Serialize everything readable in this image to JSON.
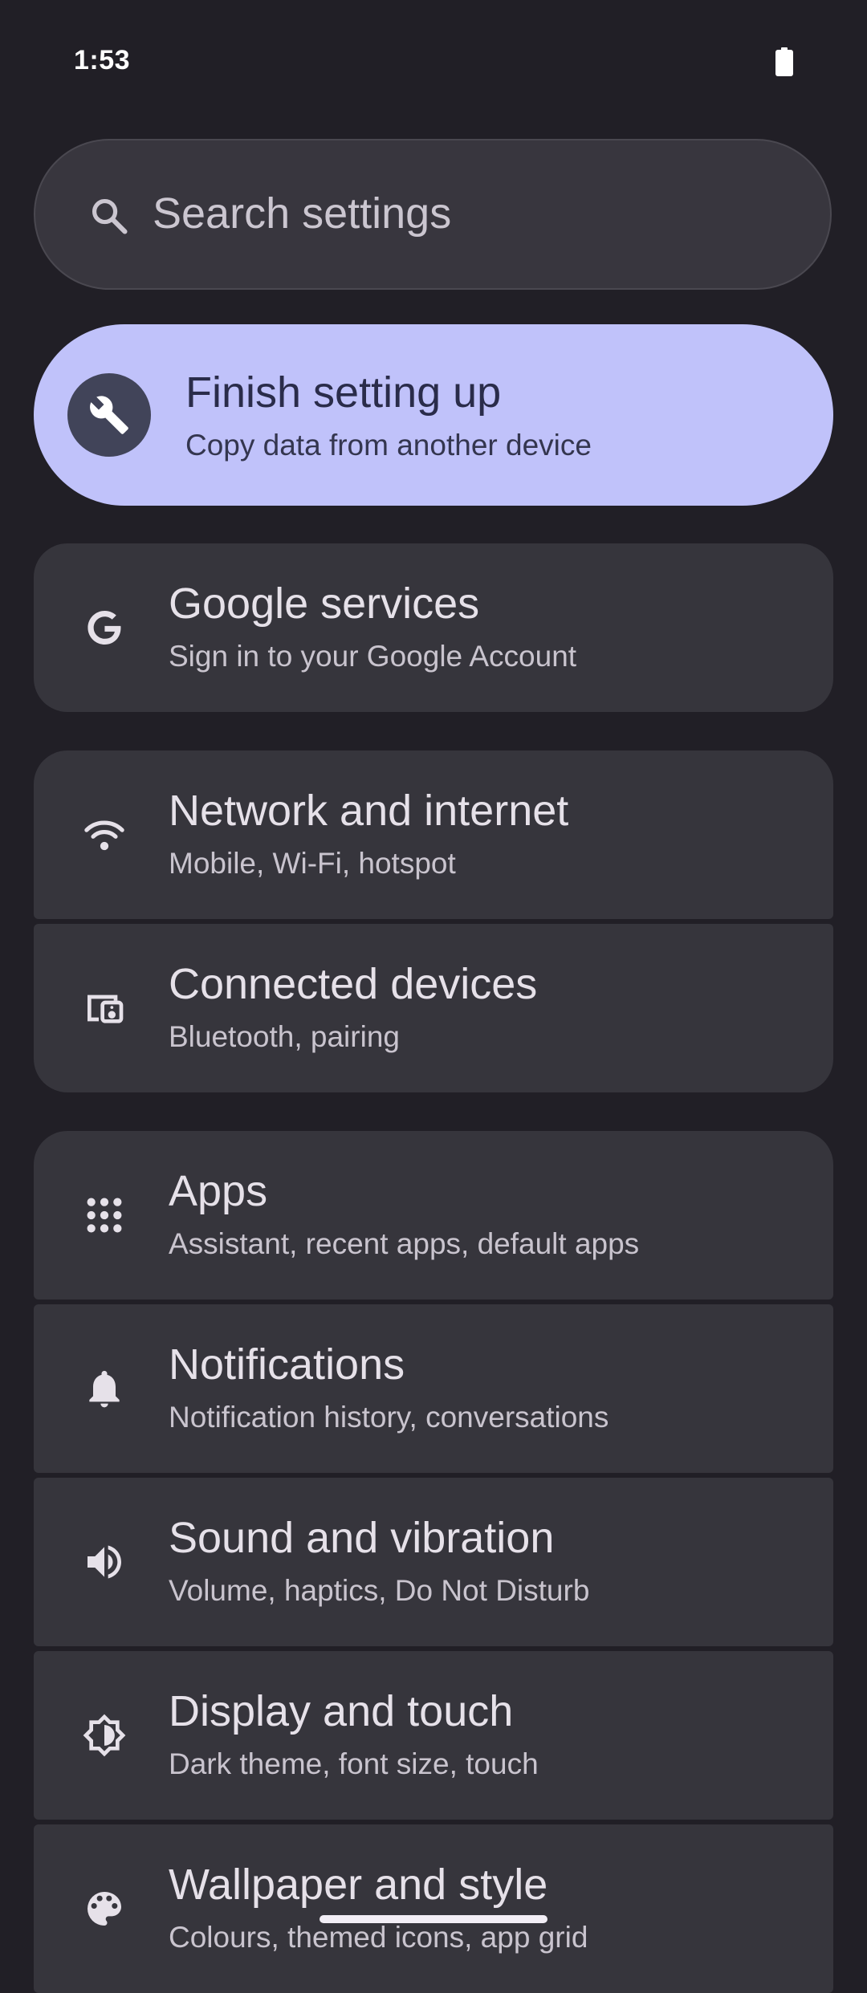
{
  "status_bar": {
    "time": "1:53"
  },
  "search": {
    "placeholder": "Search settings"
  },
  "setup": {
    "title": "Finish setting up",
    "subtitle": "Copy data from another device"
  },
  "items": [
    {
      "title": "Google services",
      "subtitle": "Sign in to your Google Account",
      "icon": "google-icon"
    },
    {
      "title": "Network and internet",
      "subtitle": "Mobile, Wi-Fi, hotspot",
      "icon": "wifi-icon"
    },
    {
      "title": "Connected devices",
      "subtitle": "Bluetooth, pairing",
      "icon": "devices-icon"
    },
    {
      "title": "Apps",
      "subtitle": "Assistant, recent apps, default apps",
      "icon": "apps-grid-icon"
    },
    {
      "title": "Notifications",
      "subtitle": "Notification history, conversations",
      "icon": "bell-icon"
    },
    {
      "title": "Sound and vibration",
      "subtitle": "Volume, haptics, Do Not Disturb",
      "icon": "speaker-icon"
    },
    {
      "title": "Display and touch",
      "subtitle": "Dark theme, font size, touch",
      "icon": "brightness-icon"
    },
    {
      "title": "Wallpaper and style",
      "subtitle": "Colours, themed icons, app grid",
      "icon": "palette-icon"
    }
  ],
  "colors": {
    "background": "#211f26",
    "card": "#36353c",
    "setup_card": "#c0c2fa",
    "primary_text": "#e6e1e9",
    "secondary_text": "#c9c4ce"
  }
}
